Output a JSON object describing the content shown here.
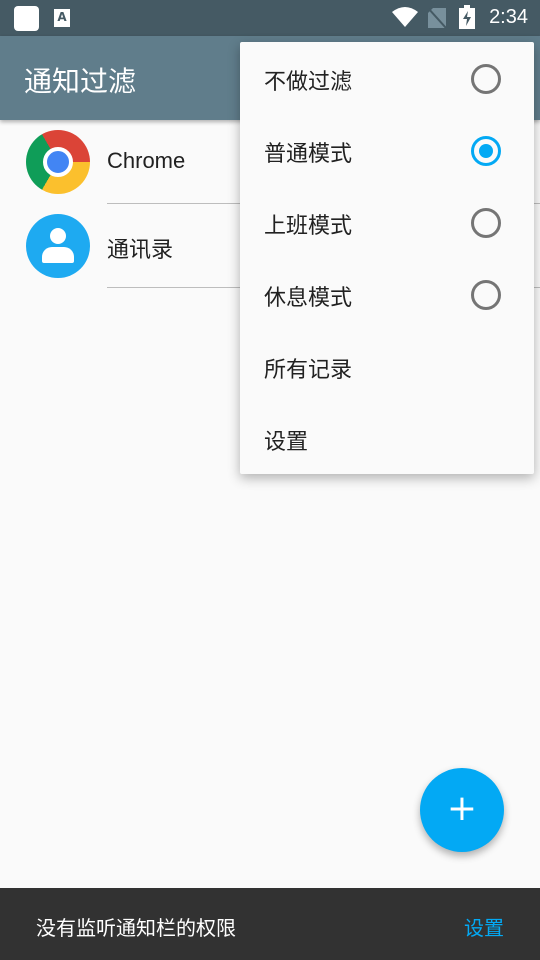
{
  "status_bar": {
    "time": "2:34",
    "icons": [
      "app-icon",
      "font-icon",
      "wifi-icon",
      "no-sim-icon",
      "battery-charging-icon"
    ]
  },
  "app_bar": {
    "title": "通知过滤"
  },
  "apps": [
    {
      "label": "Chrome",
      "icon": "chrome-icon"
    },
    {
      "label": "通讯录",
      "icon": "contacts-icon"
    }
  ],
  "menu": {
    "items": [
      {
        "label": "不做过滤",
        "radio": true,
        "selected": false
      },
      {
        "label": "普通模式",
        "radio": true,
        "selected": true
      },
      {
        "label": "上班模式",
        "radio": true,
        "selected": false
      },
      {
        "label": "休息模式",
        "radio": true,
        "selected": false
      },
      {
        "label": "所有记录",
        "radio": false
      },
      {
        "label": "设置",
        "radio": false
      }
    ]
  },
  "fab": {
    "label": "+"
  },
  "snackbar": {
    "message": "没有监听通知栏的权限",
    "action": "设置"
  },
  "colors": {
    "status": "#455a64",
    "appbar": "#607d8b",
    "accent": "#03a9f4"
  }
}
